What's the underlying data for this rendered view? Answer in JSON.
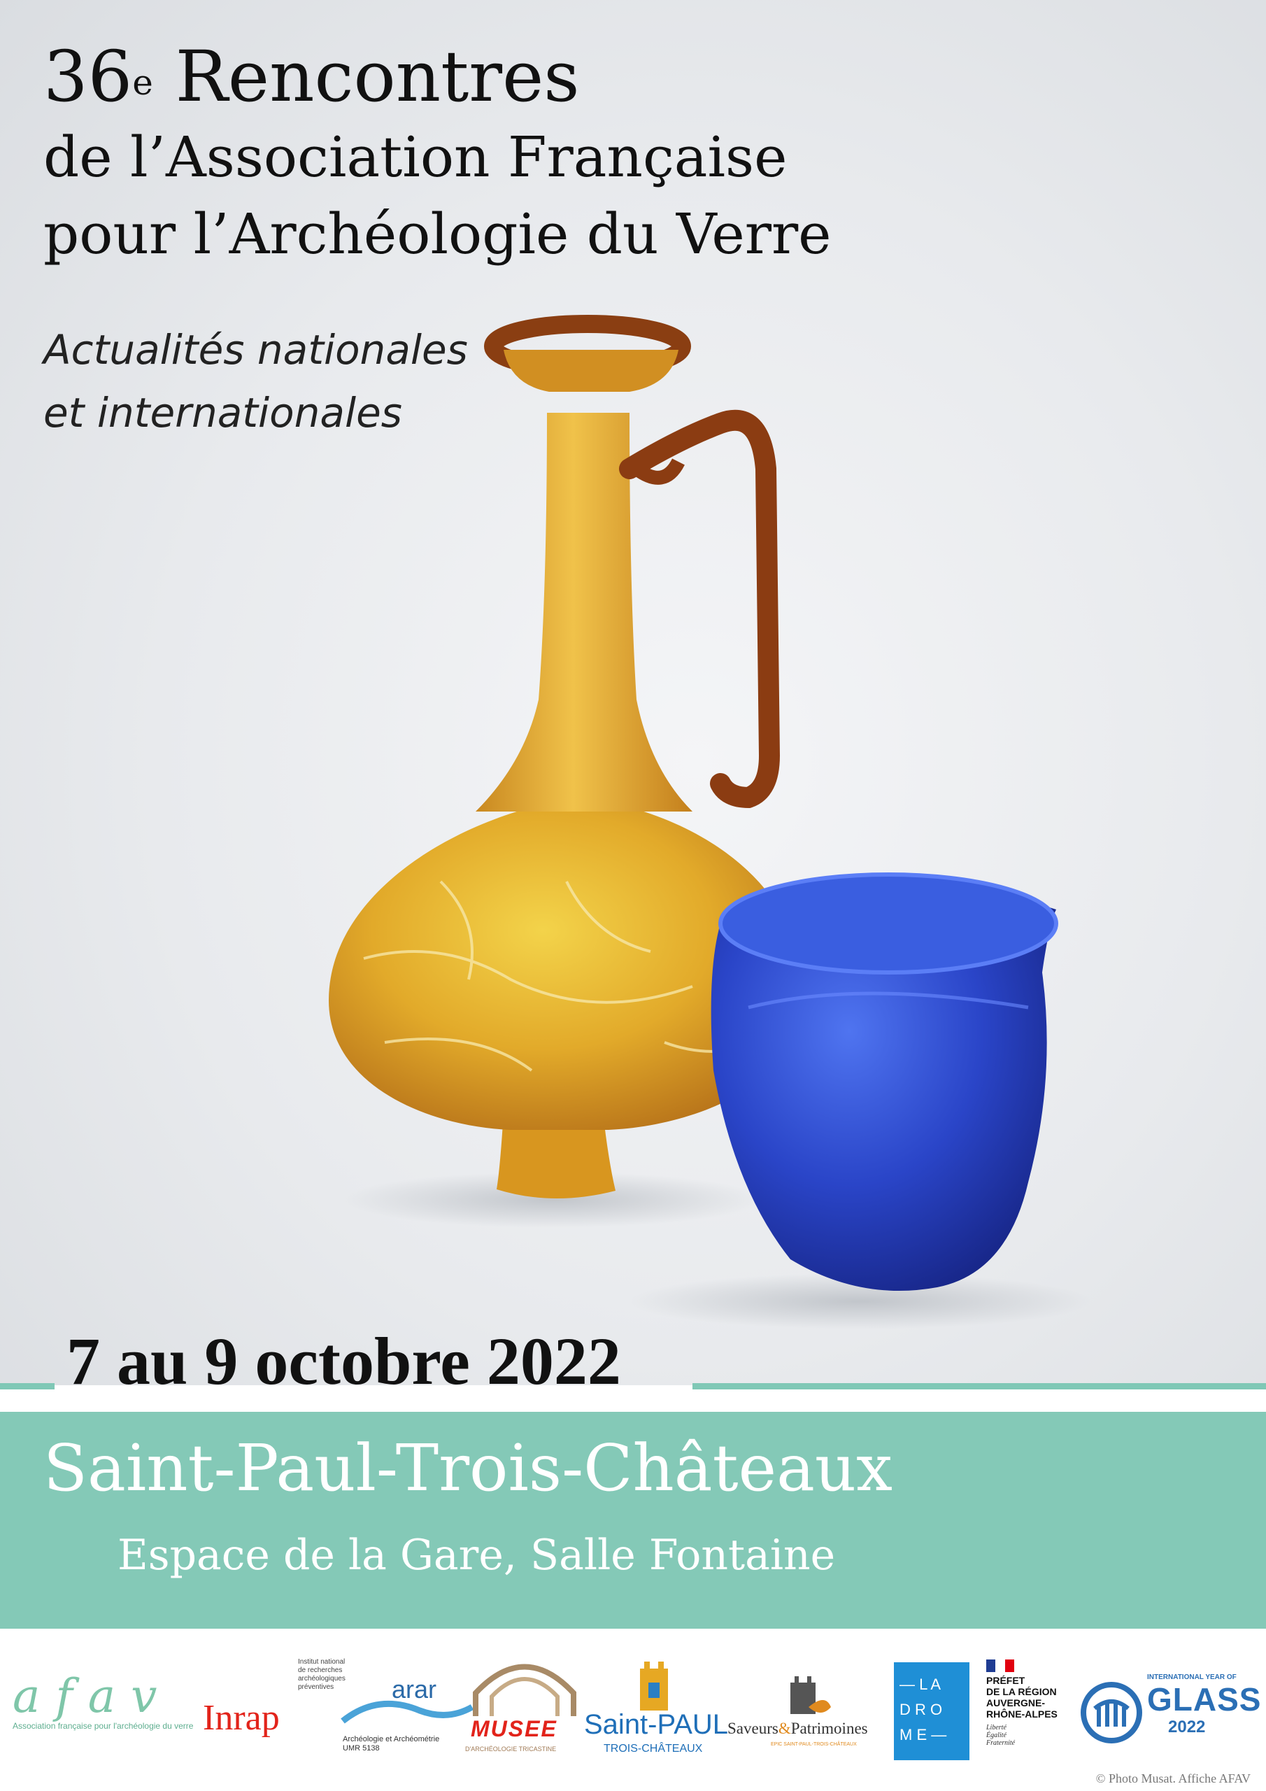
{
  "poster": {
    "title_number": "36",
    "title_sup": "e",
    "title_word": " Rencontres",
    "title_line2": "de l’Association Française",
    "title_line3": "pour l’Archéologie du Verre",
    "subtitle_line1": "Actualités nationales",
    "subtitle_line2": "et internationales",
    "dates": "7 au 9 octobre 2022",
    "city": "Saint-Paul-Trois-Châteaux",
    "venue": "Espace de la Gare, Salle Fontaine",
    "credit": "© Photo Musat. Affiche AFAV"
  },
  "colors": {
    "accent_band": "#84c9b7",
    "amber_glass": "#e0a52a",
    "blue_glass": "#2a45c8"
  },
  "sponsors": {
    "afav_name": "afav",
    "afav_tagline": "Association française pour l'archéologie du verre",
    "inrap_name": "Inrap",
    "inrap_tagline_1": "Institut national",
    "inrap_tagline_2": "de recherches",
    "inrap_tagline_3": "archéologiques",
    "inrap_tagline_4": "préventives",
    "arar_name": "arar",
    "arar_tagline_1": "Archéologie et Archéométrie",
    "arar_tagline_2": "UMR 5138",
    "musee_name": "MUSEE",
    "musee_tagline": "D'ARCHÉOLOGIE TRICASTINE",
    "saintpaul_name": "Saint-PAUL",
    "saintpaul_sub": "TROIS-CHÂTEAUX",
    "saveurs_name_1": "Saveurs",
    "saveurs_name_2": "Patrimoines",
    "saveurs_sub": "EPIC SAINT-PAUL-TROIS-CHÂTEAUX",
    "drome_l1": "— L A",
    "drome_l2": "D R O",
    "drome_l3": "M E —",
    "prefet_1": "PRÉFET",
    "prefet_2": "DE LA RÉGION",
    "prefet_3": "AUVERGNE-",
    "prefet_4": "RHÔNE-ALPES",
    "prefet_motto_1": "Liberté",
    "prefet_motto_2": "Égalité",
    "prefet_motto_3": "Fraternité",
    "iyog_top": "INTERNATIONAL YEAR OF",
    "iyog_glass": "GLASS",
    "iyog_year": "2022"
  }
}
